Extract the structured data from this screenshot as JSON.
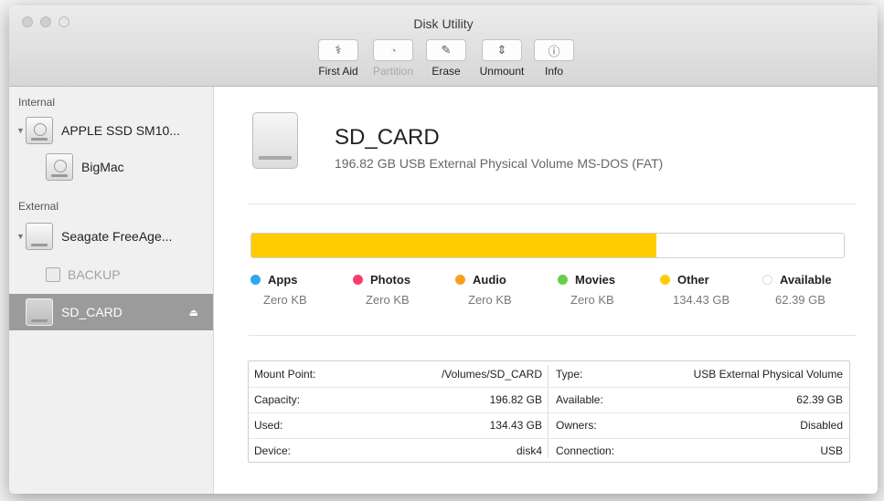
{
  "window": {
    "title": "Disk Utility"
  },
  "toolbar": {
    "buttons": [
      {
        "label": "First Aid",
        "icon": "stethoscope-icon",
        "glyph": "⚕",
        "enabled": true
      },
      {
        "label": "Partition",
        "icon": "partition-icon",
        "glyph": "◔",
        "enabled": false
      },
      {
        "label": "Erase",
        "icon": "erase-icon",
        "glyph": "✎",
        "enabled": true
      },
      {
        "label": "Unmount",
        "icon": "unmount-icon",
        "glyph": "⇕",
        "enabled": true
      },
      {
        "label": "Info",
        "icon": "info-icon",
        "glyph": "ⓘ",
        "enabled": true
      }
    ]
  },
  "sidebar": {
    "sections": [
      {
        "title": "Internal"
      },
      {
        "title": "External"
      }
    ],
    "items": [
      {
        "label": "APPLE SSD SM10...",
        "type": "disk",
        "expanded": true
      },
      {
        "label": "BigMac",
        "type": "volume"
      },
      {
        "label": "Seagate FreeAge...",
        "type": "disk",
        "expanded": true
      },
      {
        "label": "BACKUP",
        "type": "volume",
        "mounted": false
      },
      {
        "label": "SD_CARD",
        "type": "disk",
        "selected": true,
        "eject_icon": "eject-icon"
      }
    ]
  },
  "volume": {
    "name": "SD_CARD",
    "description": "196.82 GB USB External Physical Volume MS-DOS (FAT)",
    "usage": {
      "used_fraction": 0.683,
      "fill_color": "#fecc00",
      "legend": [
        {
          "name": "Apps",
          "value": "Zero KB",
          "color": "#2fa8f0"
        },
        {
          "name": "Photos",
          "value": "Zero KB",
          "color": "#f43f6c"
        },
        {
          "name": "Audio",
          "value": "Zero KB",
          "color": "#f7a01e"
        },
        {
          "name": "Movies",
          "value": "Zero KB",
          "color": "#67cf4a"
        },
        {
          "name": "Other",
          "value": "134.43 GB",
          "color": "#fecc00"
        },
        {
          "name": "Available",
          "value": "62.39 GB",
          "color": "#ffffff"
        }
      ]
    },
    "info_left": [
      {
        "label": "Mount Point:",
        "value": "/Volumes/SD_CARD"
      },
      {
        "label": "Capacity:",
        "value": "196.82 GB"
      },
      {
        "label": "Used:",
        "value": "134.43 GB"
      },
      {
        "label": "Device:",
        "value": "disk4"
      }
    ],
    "info_right": [
      {
        "label": "Type:",
        "value": "USB External Physical Volume"
      },
      {
        "label": "Available:",
        "value": "62.39 GB"
      },
      {
        "label": "Owners:",
        "value": "Disabled"
      },
      {
        "label": "Connection:",
        "value": "USB"
      }
    ]
  }
}
